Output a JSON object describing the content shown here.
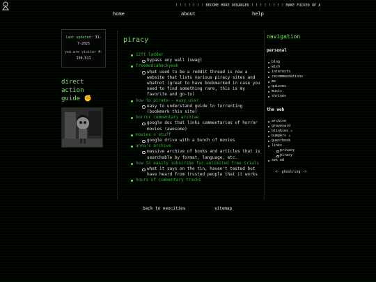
{
  "marquee": "! ! ! ! ! ! ! BECOME MORE DERANGED ! ! ! ! ! ! ! ! MAKE FUCKED UP A",
  "nav": {
    "home": "home",
    "about": "about",
    "help": "help"
  },
  "counter": {
    "updated_label": "last updated:",
    "updated_value": "31-7-2025",
    "visitor_label": "you are visitor #:",
    "visitor_value": "150,511"
  },
  "direct_action": {
    "title": "direct action guide ✊"
  },
  "page": {
    "title": "piracy",
    "items": [
      {
        "label": "12ft ladder",
        "desc": "bypass any wall (swag)"
      },
      {
        "label": "freemediaheckyeah",
        "desc": "what used to be a reddit thread is now a website that lists various piracy sites and whatnot (great to have bookmarked in case you need to find something rare, this is my favorite and go-to)"
      },
      {
        "label": "how to pirate - easy ussr",
        "desc": "easy to understand guide to torrenting (bookmark this site)"
      },
      {
        "label": "horror commentary archive",
        "desc": "google doc that links commentaries of horror movies (awesome)"
      },
      {
        "label": "movies n stuff",
        "desc": "google drive with a bunch of movies"
      },
      {
        "label": "anna's archive",
        "desc": "massive archive of books and articles that is searchable by format, language, etc."
      },
      {
        "label": "how to easily subscribe for unlimited free trials",
        "desc": "what it says on the tin, haven't tested but have heard from trusted people that it works"
      },
      {
        "label": "hours of commentary tracks",
        "desc": ""
      }
    ]
  },
  "sidebar": {
    "heading": "navigation",
    "personal_heading": "personal",
    "personal": [
      "blog",
      "wish",
      "interests",
      "recommendations",
      "me",
      "quizzes",
      "music",
      "shrines"
    ],
    "web_heading": "the web",
    "web": [
      "archive",
      "graveyard",
      "blinkies ⚠",
      "bumpers ⚠",
      "guestbook",
      "links"
    ],
    "links_sub": [
      "privacy",
      "piracy"
    ],
    "web_tail": [
      "sex ed"
    ],
    "ghostring": "<- ghostring ->"
  },
  "footer": {
    "back": "back to neocities",
    "sitemap": "sitemap"
  },
  "colors": {
    "accent_green": "#7ee05a",
    "link_green": "#2fb82f",
    "background": "#000000"
  }
}
